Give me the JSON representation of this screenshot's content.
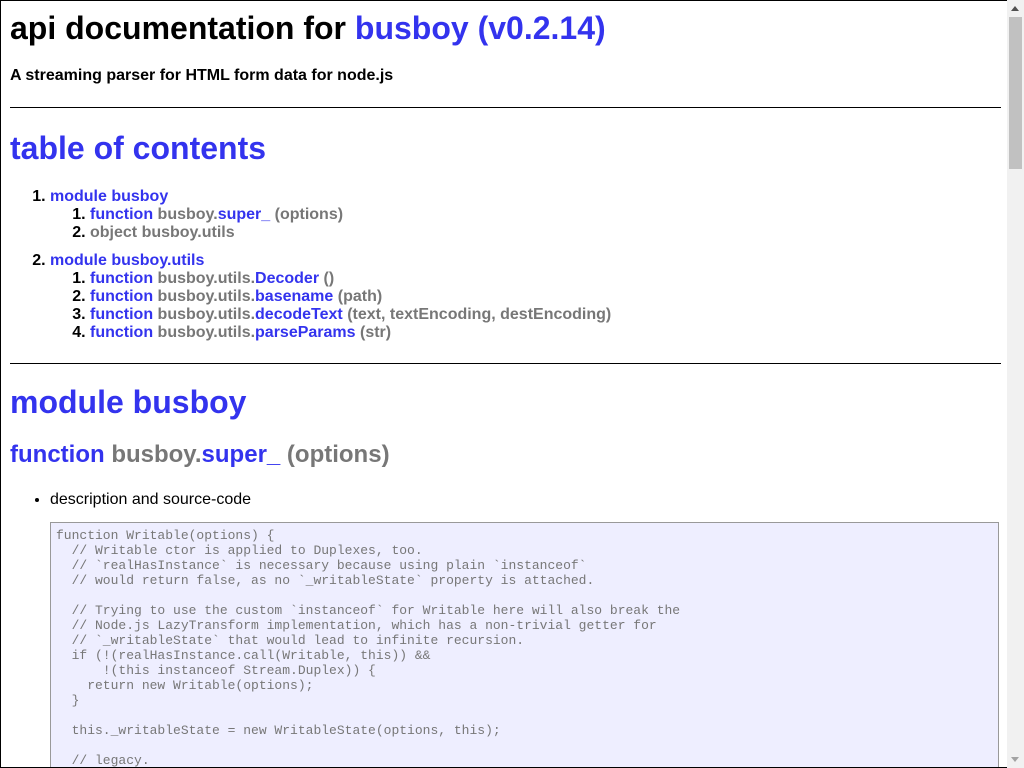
{
  "header": {
    "title_prefix": "api documentation for",
    "title_link": "busboy (v0.2.14)",
    "tagline": "A streaming parser for HTML form data for node.js"
  },
  "toc": {
    "heading": "table of contents",
    "modules": [
      {
        "label": "module busboy",
        "items": [
          {
            "kind": "function",
            "prefix": "busboy.",
            "name": "super_",
            "args": "(options)"
          },
          {
            "kind": "object",
            "text": "object busboy.utils"
          }
        ]
      },
      {
        "label": "module busboy.utils",
        "items": [
          {
            "kind": "function",
            "prefix": "busboy.utils.",
            "name": "Decoder",
            "args": "()"
          },
          {
            "kind": "function",
            "prefix": "busboy.utils.",
            "name": "basename",
            "args": "(path)"
          },
          {
            "kind": "function",
            "prefix": "busboy.utils.",
            "name": "decodeText",
            "args": "(text, textEncoding, destEncoding)"
          },
          {
            "kind": "function",
            "prefix": "busboy.utils.",
            "name": "parseParams",
            "args": "(str)"
          }
        ]
      }
    ]
  },
  "module_section": {
    "heading": "module busboy",
    "function": {
      "kind": "function",
      "prefix": "busboy.",
      "name": "super_",
      "args": "(options)"
    },
    "bullet": "description and source-code",
    "code": "function Writable(options) {\n  // Writable ctor is applied to Duplexes, too.\n  // `realHasInstance` is necessary because using plain `instanceof`\n  // would return false, as no `_writableState` property is attached.\n\n  // Trying to use the custom `instanceof` for Writable here will also break the\n  // Node.js LazyTransform implementation, which has a non-trivial getter for\n  // `_writableState` that would lead to infinite recursion.\n  if (!(realHasInstance.call(Writable, this)) &&\n      !(this instanceof Stream.Duplex)) {\n    return new Writable(options);\n  }\n\n  this._writableState = new WritableState(options, this);\n\n  // legacy."
  }
}
